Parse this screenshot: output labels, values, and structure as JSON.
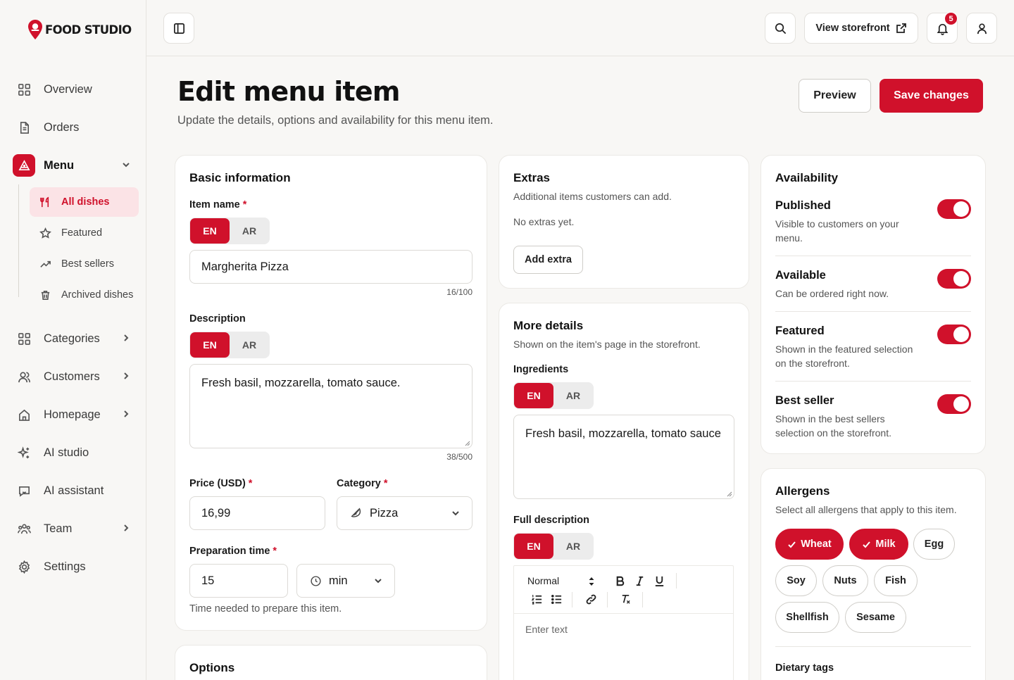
{
  "brand": {
    "name": "FOOD STUDIO",
    "accent": "#d0112b"
  },
  "sidebar": {
    "items": [
      {
        "label": "Overview",
        "icon": "grid-icon"
      },
      {
        "label": "Orders",
        "icon": "document-icon"
      },
      {
        "label": "Menu",
        "icon": "pizza-slice-icon"
      },
      {
        "label": "Categories",
        "icon": "grid-icon"
      },
      {
        "label": "Customers",
        "icon": "users-icon"
      },
      {
        "label": "Homepage",
        "icon": "home-icon"
      },
      {
        "label": "AI studio",
        "icon": "sparkles-icon"
      },
      {
        "label": "AI assistant",
        "icon": "chat-bot-icon"
      },
      {
        "label": "Team",
        "icon": "team-icon"
      },
      {
        "label": "Settings",
        "icon": "gear-icon"
      }
    ],
    "menu_sub": [
      {
        "label": "All dishes",
        "icon": "utensils-icon"
      },
      {
        "label": "Featured",
        "icon": "star-icon"
      },
      {
        "label": "Best sellers",
        "icon": "trending-up-icon"
      },
      {
        "label": "Archived dishes",
        "icon": "trash-icon"
      }
    ]
  },
  "topbar": {
    "storefront_label": "View storefront",
    "notification_count": "5"
  },
  "header": {
    "title": "Edit menu item",
    "subtitle": "Update the details, options and availability for this menu item.",
    "preview_label": "Preview",
    "save_label": "Save changes"
  },
  "basic": {
    "title": "Basic information",
    "item_name_label": "Item name",
    "item_name_value": "Margherita Pizza",
    "item_name_counter": "16/100",
    "description_label": "Description",
    "description_value": "Fresh basil, mozzarella, tomato sauce.",
    "description_counter": "38/500",
    "price_label": "Price (USD)",
    "price_value": "16,99",
    "category_label": "Category",
    "category_value": "Pizza",
    "prep_label": "Preparation time",
    "prep_value": "15",
    "prep_unit": "min",
    "prep_hint": "Time needed to prepare this item.",
    "lang_en": "EN",
    "lang_ar": "AR",
    "required_mark": "*"
  },
  "options": {
    "title": "Options"
  },
  "extras": {
    "title": "Extras",
    "desc": "Additional items customers can add.",
    "empty": "No extras yet.",
    "add_label": "Add extra"
  },
  "more": {
    "title": "More details",
    "desc": "Shown on the item's page in the storefront.",
    "ingredients_label": "Ingredients",
    "ingredients_value": "Fresh basil, mozzarella, tomato sauce",
    "full_desc_label": "Full description",
    "format_value": "Normal",
    "editor_placeholder": "Enter text"
  },
  "availability": {
    "title": "Availability",
    "rows": [
      {
        "title": "Published",
        "desc": "Visible to customers on your menu.",
        "on": true
      },
      {
        "title": "Available",
        "desc": "Can be ordered right now.",
        "on": true
      },
      {
        "title": "Featured",
        "desc": "Shown in the featured selection on the storefront.",
        "on": true
      },
      {
        "title": "Best seller",
        "desc": "Shown in the best sellers selection on the storefront.",
        "on": true
      }
    ]
  },
  "allergens": {
    "title": "Allergens",
    "desc": "Select all allergens that apply to this item.",
    "chips": [
      {
        "label": "Wheat",
        "selected": true
      },
      {
        "label": "Milk",
        "selected": true
      },
      {
        "label": "Egg",
        "selected": false
      },
      {
        "label": "Soy",
        "selected": false
      },
      {
        "label": "Nuts",
        "selected": false
      },
      {
        "label": "Fish",
        "selected": false
      },
      {
        "label": "Shellfish",
        "selected": false
      },
      {
        "label": "Sesame",
        "selected": false
      }
    ],
    "dietary_label": "Dietary tags"
  }
}
